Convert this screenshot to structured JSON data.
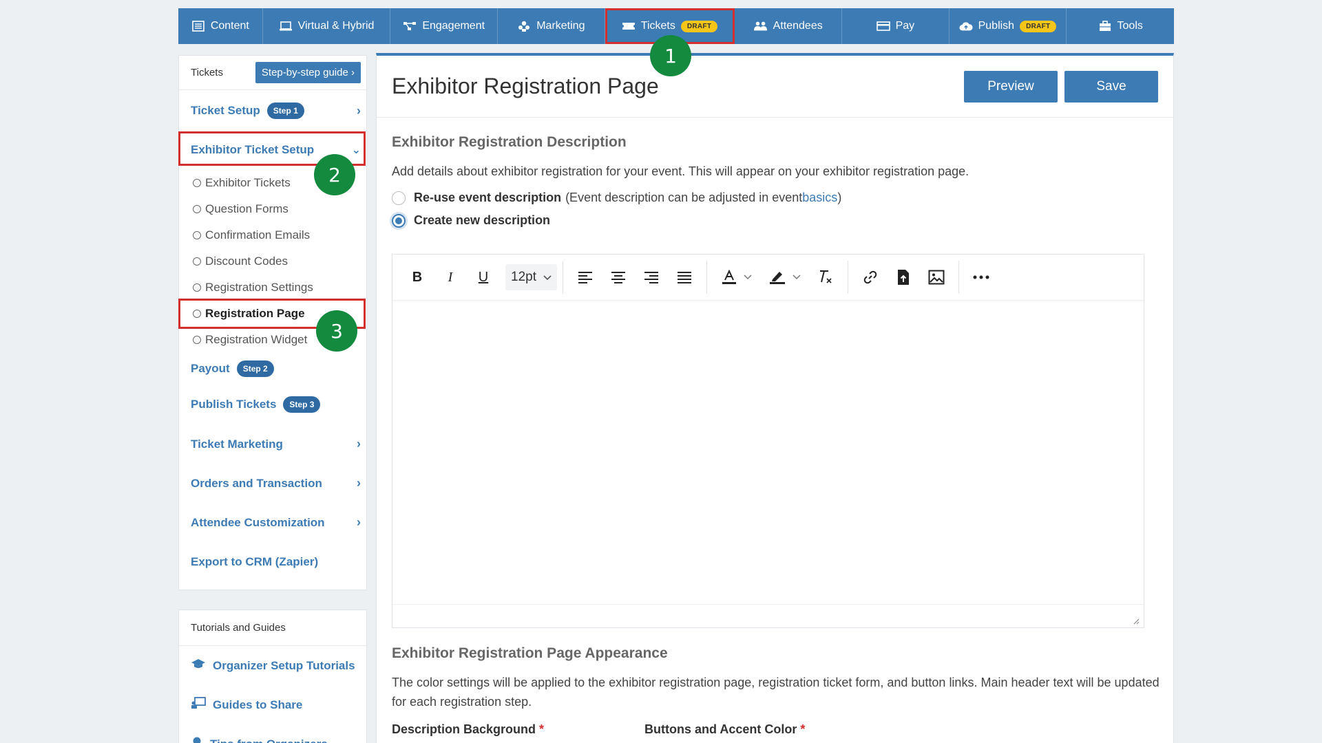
{
  "topnav": {
    "items": [
      {
        "label": "Content",
        "icon": "list-icon"
      },
      {
        "label": "Virtual & Hybrid",
        "icon": "laptop-icon"
      },
      {
        "label": "Engagement",
        "icon": "network-icon"
      },
      {
        "label": "Marketing",
        "icon": "people-group-icon"
      },
      {
        "label": "Tickets",
        "icon": "ticket-icon",
        "badge": "DRAFT"
      },
      {
        "label": "Attendees",
        "icon": "users-icon"
      },
      {
        "label": "Pay",
        "icon": "credit-card-icon"
      },
      {
        "label": "Publish",
        "icon": "cloud-upload-icon",
        "badge": "DRAFT"
      },
      {
        "label": "Tools",
        "icon": "briefcase-icon"
      }
    ]
  },
  "markers": [
    "1",
    "2",
    "3"
  ],
  "sidebar": {
    "header": "Tickets",
    "guide_button": "Step-by-step guide",
    "ticket_setup": {
      "label": "Ticket Setup",
      "badge": "Step 1"
    },
    "exhibitor_setup": {
      "label": "Exhibitor Ticket Setup"
    },
    "sub_items": [
      "Exhibitor Tickets",
      "Question Forms",
      "Confirmation Emails",
      "Discount Codes",
      "Registration Settings",
      "Registration Page",
      "Registration Widget"
    ],
    "payout": {
      "label": "Payout",
      "badge": "Step 2"
    },
    "publish": {
      "label": "Publish Tickets",
      "badge": "Step 3"
    },
    "ticket_marketing": "Ticket Marketing",
    "orders": "Orders and Transaction",
    "attendee_custom": "Attendee Customization",
    "export": "Export to CRM (Zapier)"
  },
  "sidebar2": {
    "header": "Tutorials and Guides",
    "items": [
      {
        "label": "Organizer Setup Tutorials",
        "icon": "graduation-cap-icon"
      },
      {
        "label": "Guides to Share",
        "icon": "presentation-icon"
      },
      {
        "label": "Tips from Organizers",
        "icon": "bulb-icon"
      }
    ]
  },
  "main": {
    "title": "Exhibitor Registration Page",
    "preview_label": "Preview",
    "save_label": "Save",
    "desc_section_title": "Exhibitor Registration Description",
    "desc_intro": "Add details about exhibitor registration for your event. This will appear on your exhibitor registration page.",
    "radio_reuse_bold": "Re-use event description",
    "radio_reuse_note_pre": "(Event description can be adjusted in event ",
    "radio_reuse_link": "basics",
    "radio_reuse_note_post": ")",
    "radio_new": "Create new description",
    "selected_radio": "new",
    "font_size": "12pt",
    "appearance_title": "Exhibitor Registration Page Appearance",
    "appearance_text": "The color settings will be applied to the exhibitor registration page, registration ticket form, and button links. Main header text will be updated for each registration step.",
    "field_bg_label": "Description Background",
    "field_accent_label": "Buttons and Accent Color",
    "required_mark": "*"
  },
  "colors": {
    "brand": "#3d7bb5",
    "highlight": "#d32f2f",
    "marker": "#138a3e",
    "draft": "#f5c518"
  }
}
